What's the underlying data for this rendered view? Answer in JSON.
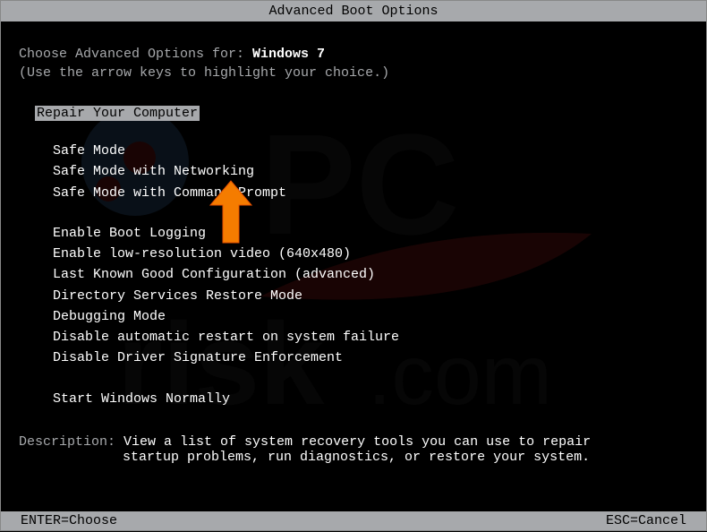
{
  "title": "Advanced Boot Options",
  "header": {
    "prefix": "Choose Advanced Options for: ",
    "os": "Windows 7",
    "instructions": "(Use the arrow keys to highlight your choice.)"
  },
  "selected": "Repair Your Computer",
  "menu_group1": [
    "Safe Mode",
    "Safe Mode with Networking",
    "Safe Mode with Command Prompt"
  ],
  "menu_group2": [
    "Enable Boot Logging",
    "Enable low-resolution video (640x480)",
    "Last Known Good Configuration (advanced)",
    "Directory Services Restore Mode",
    "Debugging Mode",
    "Disable automatic restart on system failure",
    "Disable Driver Signature Enforcement"
  ],
  "menu_group3": [
    "Start Windows Normally"
  ],
  "description": {
    "label": "Description: ",
    "line1": "View a list of system recovery tools you can use to repair",
    "line2": "startup problems, run diagnostics, or restore your system."
  },
  "footer": {
    "left": "ENTER=Choose",
    "right": "ESC=Cancel"
  }
}
